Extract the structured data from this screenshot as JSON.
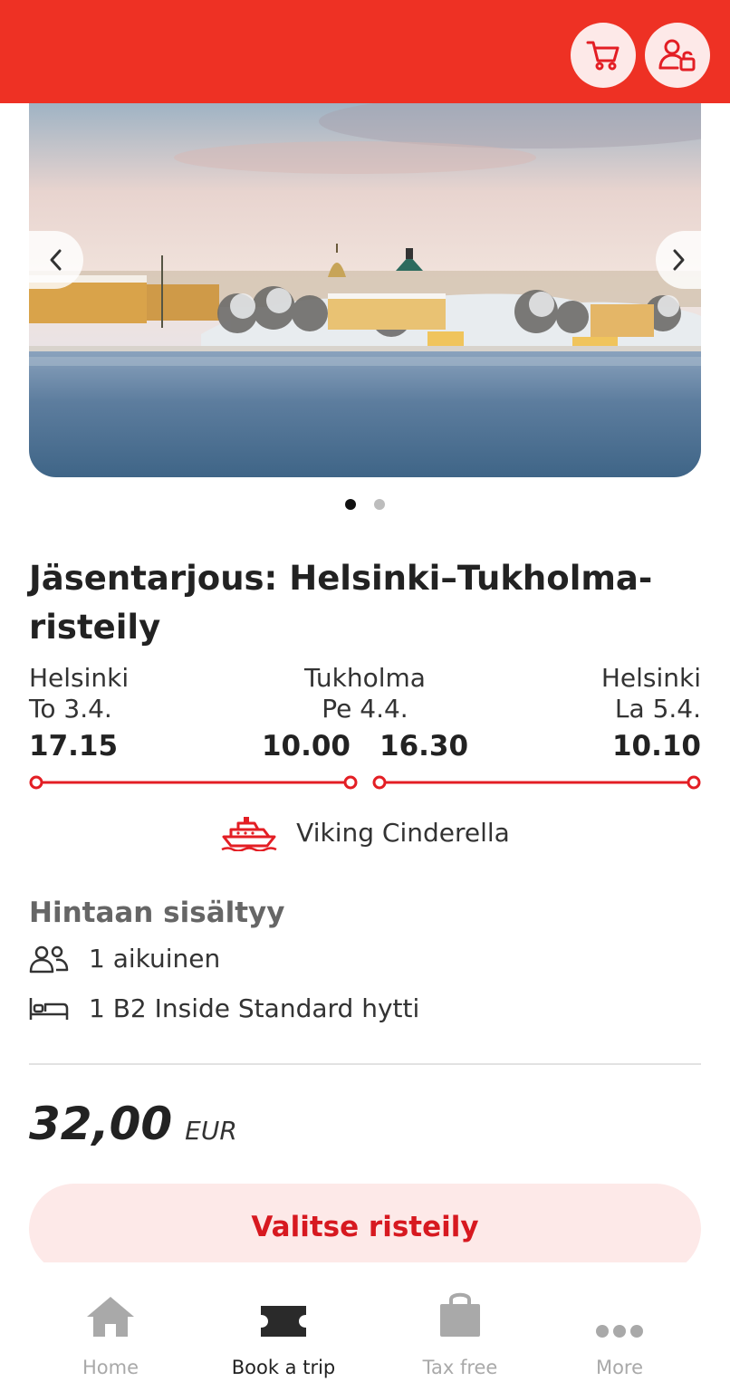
{
  "header": {
    "cart_icon": "cart-icon",
    "account_icon": "account-lock-icon",
    "brand_color": "#ee3124"
  },
  "carousel": {
    "slide_count": 2,
    "active_index": 0,
    "prev_icon": "chevron-left-icon",
    "next_icon": "chevron-right-icon"
  },
  "offer": {
    "title": "Jäsentarjous: Helsinki–Tukholma-risteily"
  },
  "route": {
    "departure": {
      "city": "Helsinki",
      "date": "To 3.4.",
      "time": "17.15"
    },
    "destination": {
      "city": "Tukholma",
      "date": "Pe 4.4.",
      "arrival_time": "10.00",
      "departure_time": "16.30"
    },
    "return": {
      "city": "Helsinki",
      "date": "La 5.4.",
      "time": "10.10"
    }
  },
  "ship": {
    "icon": "ship-icon",
    "name": "Viking Cinderella"
  },
  "included": {
    "title": "Hintaan sisältyy",
    "items": [
      {
        "icon": "people-icon",
        "text": "1 aikuinen"
      },
      {
        "icon": "bed-icon",
        "text": "1 B2 Inside Standard hytti"
      }
    ]
  },
  "price": {
    "amount": "32,00",
    "currency": "EUR"
  },
  "cta": {
    "label": "Valitse risteily"
  },
  "bottom_nav": {
    "items": [
      {
        "icon": "home-icon",
        "label": "Home",
        "active": false
      },
      {
        "icon": "ticket-icon",
        "label": "Book a trip",
        "active": true
      },
      {
        "icon": "shopping-bag-icon",
        "label": "Tax free",
        "active": false
      },
      {
        "icon": "more-icon",
        "label": "More",
        "active": false
      }
    ]
  }
}
